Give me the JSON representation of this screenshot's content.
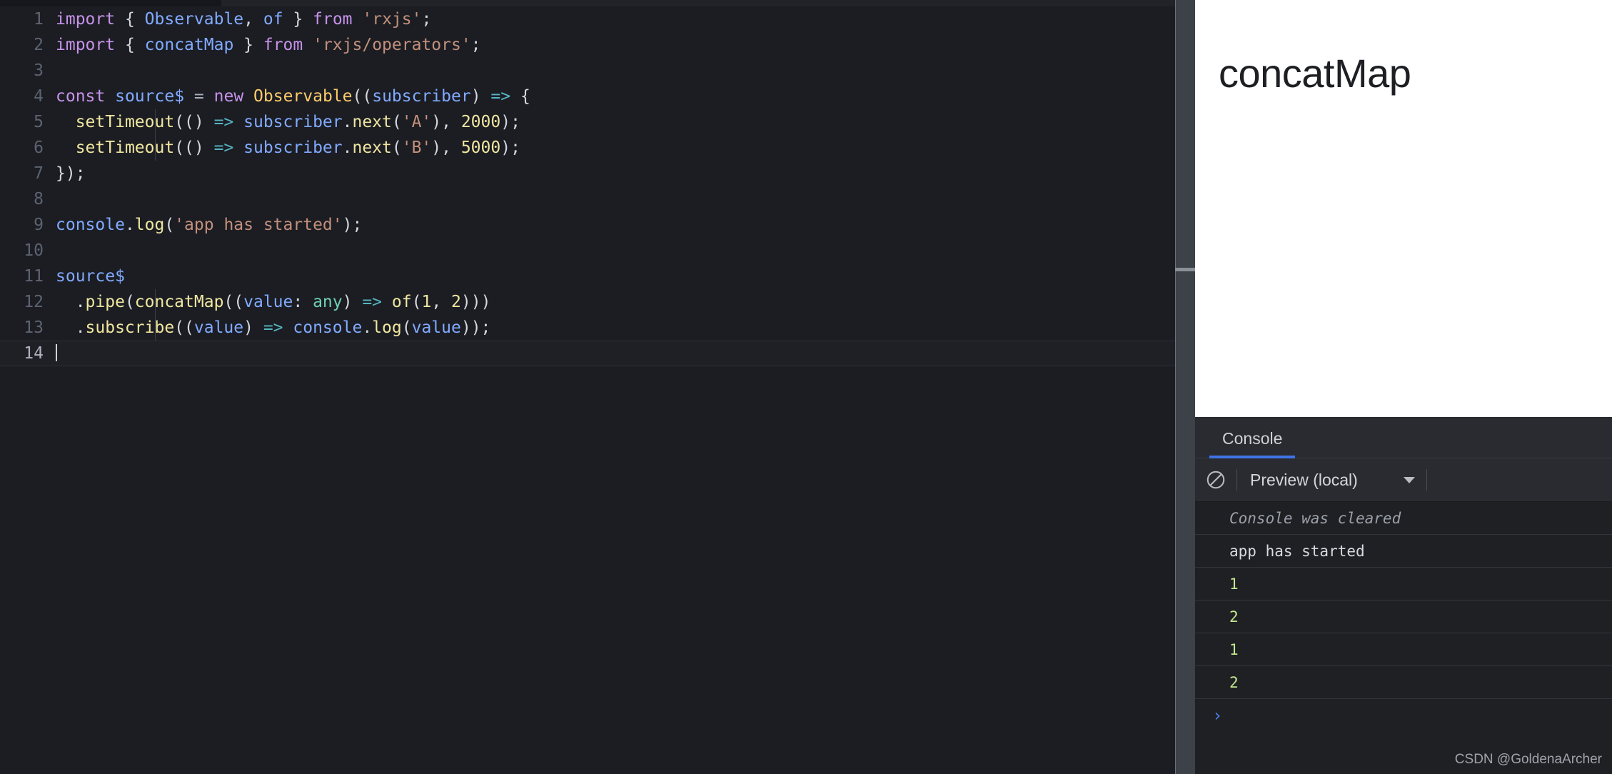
{
  "editor": {
    "name": "code-editor",
    "active_line": 14,
    "lines": [
      {
        "n": "1",
        "tokens": [
          {
            "t": "import",
            "c": "k"
          },
          {
            "t": " ",
            "c": "p"
          },
          {
            "t": "{",
            "c": "p"
          },
          {
            "t": " ",
            "c": "p"
          },
          {
            "t": "Observable",
            "c": "v"
          },
          {
            "t": ", ",
            "c": "p"
          },
          {
            "t": "of",
            "c": "v"
          },
          {
            "t": " }",
            "c": "p"
          },
          {
            "t": " ",
            "c": "p"
          },
          {
            "t": "from",
            "c": "k"
          },
          {
            "t": " ",
            "c": "p"
          },
          {
            "t": "'rxjs'",
            "c": "s"
          },
          {
            "t": ";",
            "c": "p"
          }
        ]
      },
      {
        "n": "2",
        "tokens": [
          {
            "t": "import",
            "c": "k"
          },
          {
            "t": " ",
            "c": "p"
          },
          {
            "t": "{",
            "c": "p"
          },
          {
            "t": " ",
            "c": "p"
          },
          {
            "t": "concatMap",
            "c": "v"
          },
          {
            "t": " }",
            "c": "p"
          },
          {
            "t": " ",
            "c": "p"
          },
          {
            "t": "from",
            "c": "k"
          },
          {
            "t": " ",
            "c": "p"
          },
          {
            "t": "'rxjs/operators'",
            "c": "s"
          },
          {
            "t": ";",
            "c": "p"
          }
        ]
      },
      {
        "n": "3",
        "tokens": []
      },
      {
        "n": "4",
        "tokens": [
          {
            "t": "const",
            "c": "k"
          },
          {
            "t": " ",
            "c": "p"
          },
          {
            "t": "source$",
            "c": "v"
          },
          {
            "t": " ",
            "c": "p"
          },
          {
            "t": "=",
            "c": "op"
          },
          {
            "t": " ",
            "c": "p"
          },
          {
            "t": "new",
            "c": "k"
          },
          {
            "t": " ",
            "c": "p"
          },
          {
            "t": "Observable",
            "c": "cls"
          },
          {
            "t": "((",
            "c": "p"
          },
          {
            "t": "subscriber",
            "c": "v"
          },
          {
            "t": ") ",
            "c": "p"
          },
          {
            "t": "=>",
            "c": "ar"
          },
          {
            "t": " {",
            "c": "p"
          }
        ]
      },
      {
        "n": "5",
        "tokens": [
          {
            "t": "  ",
            "c": "p"
          },
          {
            "t": "setTimeout",
            "c": "fn"
          },
          {
            "t": "(() ",
            "c": "p"
          },
          {
            "t": "=>",
            "c": "ar"
          },
          {
            "t": " ",
            "c": "p"
          },
          {
            "t": "subscriber",
            "c": "v"
          },
          {
            "t": ".",
            "c": "p"
          },
          {
            "t": "next",
            "c": "fn"
          },
          {
            "t": "(",
            "c": "p"
          },
          {
            "t": "'A'",
            "c": "s"
          },
          {
            "t": "), ",
            "c": "p"
          },
          {
            "t": "2000",
            "c": "num"
          },
          {
            "t": ");",
            "c": "p"
          }
        ],
        "guide": true
      },
      {
        "n": "6",
        "tokens": [
          {
            "t": "  ",
            "c": "p"
          },
          {
            "t": "setTimeout",
            "c": "fn"
          },
          {
            "t": "(() ",
            "c": "p"
          },
          {
            "t": "=>",
            "c": "ar"
          },
          {
            "t": " ",
            "c": "p"
          },
          {
            "t": "subscriber",
            "c": "v"
          },
          {
            "t": ".",
            "c": "p"
          },
          {
            "t": "next",
            "c": "fn"
          },
          {
            "t": "(",
            "c": "p"
          },
          {
            "t": "'B'",
            "c": "s"
          },
          {
            "t": "), ",
            "c": "p"
          },
          {
            "t": "5000",
            "c": "num"
          },
          {
            "t": ");",
            "c": "p"
          }
        ],
        "guide": true
      },
      {
        "n": "7",
        "tokens": [
          {
            "t": "});",
            "c": "p"
          }
        ]
      },
      {
        "n": "8",
        "tokens": []
      },
      {
        "n": "9",
        "tokens": [
          {
            "t": "console",
            "c": "v"
          },
          {
            "t": ".",
            "c": "p"
          },
          {
            "t": "log",
            "c": "fn"
          },
          {
            "t": "(",
            "c": "p"
          },
          {
            "t": "'app has started'",
            "c": "s"
          },
          {
            "t": ");",
            "c": "p"
          }
        ]
      },
      {
        "n": "10",
        "tokens": []
      },
      {
        "n": "11",
        "tokens": [
          {
            "t": "source$",
            "c": "v"
          }
        ]
      },
      {
        "n": "12",
        "tokens": [
          {
            "t": "  .",
            "c": "p"
          },
          {
            "t": "pipe",
            "c": "fn"
          },
          {
            "t": "(",
            "c": "p"
          },
          {
            "t": "concatMap",
            "c": "fn"
          },
          {
            "t": "((",
            "c": "p"
          },
          {
            "t": "value",
            "c": "v"
          },
          {
            "t": ": ",
            "c": "p"
          },
          {
            "t": "any",
            "c": "ty"
          },
          {
            "t": ") ",
            "c": "p"
          },
          {
            "t": "=>",
            "c": "ar"
          },
          {
            "t": " ",
            "c": "p"
          },
          {
            "t": "of",
            "c": "fn"
          },
          {
            "t": "(",
            "c": "p"
          },
          {
            "t": "1",
            "c": "num"
          },
          {
            "t": ", ",
            "c": "p"
          },
          {
            "t": "2",
            "c": "num"
          },
          {
            "t": ")))",
            "c": "p"
          }
        ],
        "guide": true
      },
      {
        "n": "13",
        "tokens": [
          {
            "t": "  .",
            "c": "p"
          },
          {
            "t": "subscribe",
            "c": "fn"
          },
          {
            "t": "((",
            "c": "p"
          },
          {
            "t": "value",
            "c": "v"
          },
          {
            "t": ") ",
            "c": "p"
          },
          {
            "t": "=>",
            "c": "ar"
          },
          {
            "t": " ",
            "c": "p"
          },
          {
            "t": "console",
            "c": "v"
          },
          {
            "t": ".",
            "c": "p"
          },
          {
            "t": "log",
            "c": "fn"
          },
          {
            "t": "(",
            "c": "p"
          },
          {
            "t": "value",
            "c": "v"
          },
          {
            "t": "));",
            "c": "p"
          }
        ],
        "guide": true
      },
      {
        "n": "14",
        "tokens": []
      }
    ]
  },
  "preview": {
    "heading": "concatMap"
  },
  "console": {
    "tab_label": "Console",
    "clear_icon": "clear-console-icon",
    "context_label": "Preview (local)",
    "dropdown_icon": "chevron-down-icon",
    "prompt_symbol": "›",
    "entries": [
      {
        "text": "Console was cleared",
        "style": "cleared"
      },
      {
        "text": "app has started",
        "style": "text"
      },
      {
        "text": "1",
        "style": "numeric"
      },
      {
        "text": "2",
        "style": "numeric"
      },
      {
        "text": "1",
        "style": "numeric"
      },
      {
        "text": "2",
        "style": "numeric"
      }
    ]
  },
  "watermark": {
    "text": "CSDN @GoldenaArcher"
  },
  "colors": {
    "editor_bg": "#1b1d23",
    "preview_bg": "#ffffff",
    "console_bg": "#1f2024",
    "accent_tab": "#3e74e6",
    "numeric_log": "#c3e88d",
    "keyword": "#c792ea",
    "string": "#c3907b",
    "class": "#ffcb6b"
  }
}
